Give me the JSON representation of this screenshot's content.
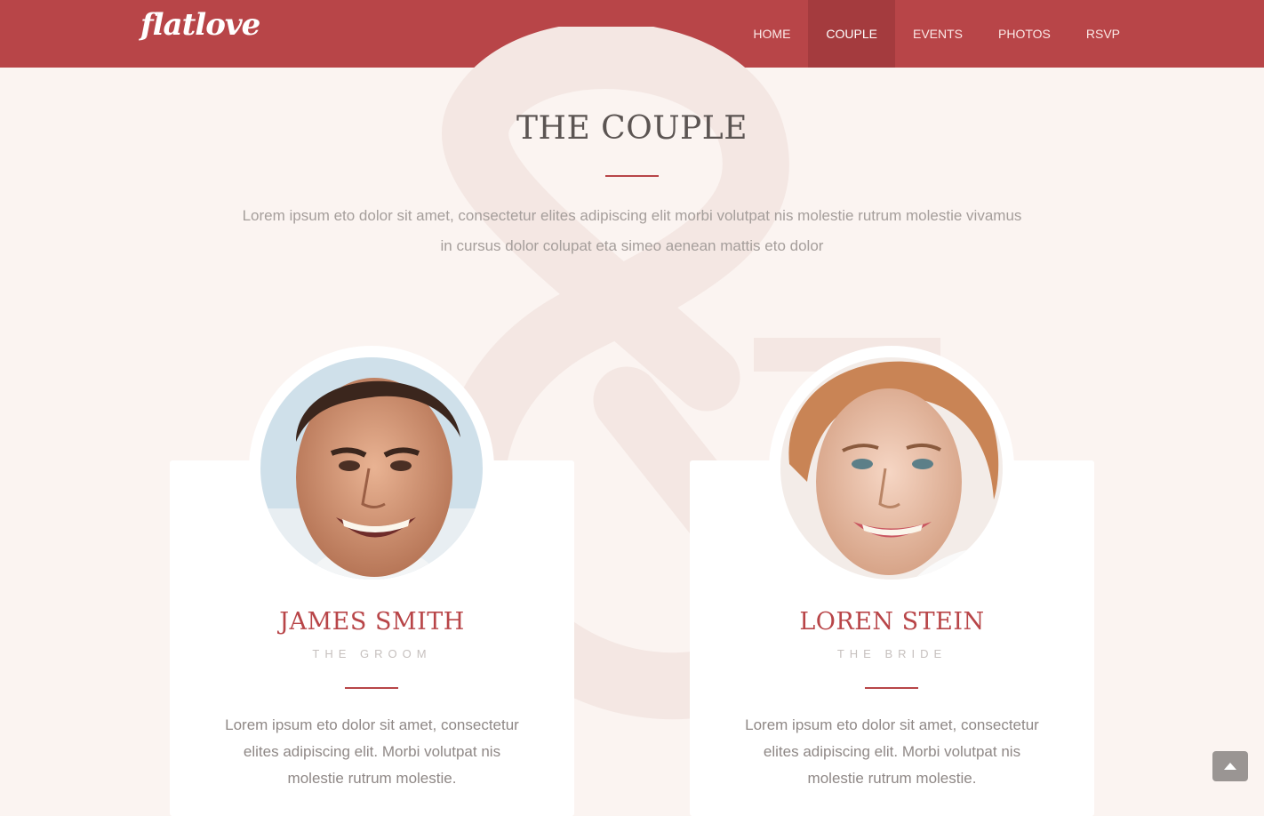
{
  "nav": {
    "logo": "flatlove",
    "items": [
      {
        "label": "HOME",
        "active": false
      },
      {
        "label": "COUPLE",
        "active": true
      },
      {
        "label": "EVENTS",
        "active": false
      },
      {
        "label": "PHOTOS",
        "active": false
      },
      {
        "label": "RSVP",
        "active": false
      }
    ]
  },
  "section": {
    "title": "THE COUPLE",
    "intro": "Lorem ipsum eto dolor sit amet, consectetur elites adipiscing elit morbi volutpat nis molestie rutrum molestie vivamus in cursus dolor colupat eta simeo aenean mattis eto dolor"
  },
  "couple": [
    {
      "name": "JAMES SMITH",
      "role": "THE GROOM",
      "bio": "Lorem ipsum eto dolor sit amet, consectetur elites adipiscing elit. Morbi volutpat nis molestie rutrum molestie."
    },
    {
      "name": "LOREN STEIN",
      "role": "THE BRIDE",
      "bio": "Lorem ipsum eto dolor sit amet, consectetur elites adipiscing elit. Morbi volutpat nis molestie rutrum molestie."
    }
  ],
  "colors": {
    "primary": "#b84548",
    "primary_dark": "#a43b3e",
    "background": "#fbf4f1",
    "card": "#ffffff"
  },
  "icons": {
    "scroll_top": "chevron-up-icon"
  }
}
